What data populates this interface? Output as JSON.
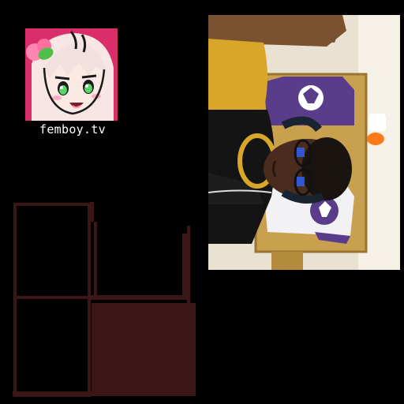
{
  "logo": {
    "caption": "femboy.tv",
    "icon": "anime-mascot-icon",
    "background_color": "#d92e6a"
  },
  "webcam": {
    "icon": "webcam-feed-image"
  },
  "pixel_panel": {
    "icon": "pixel-grid-frame",
    "color": "#3a1716"
  }
}
